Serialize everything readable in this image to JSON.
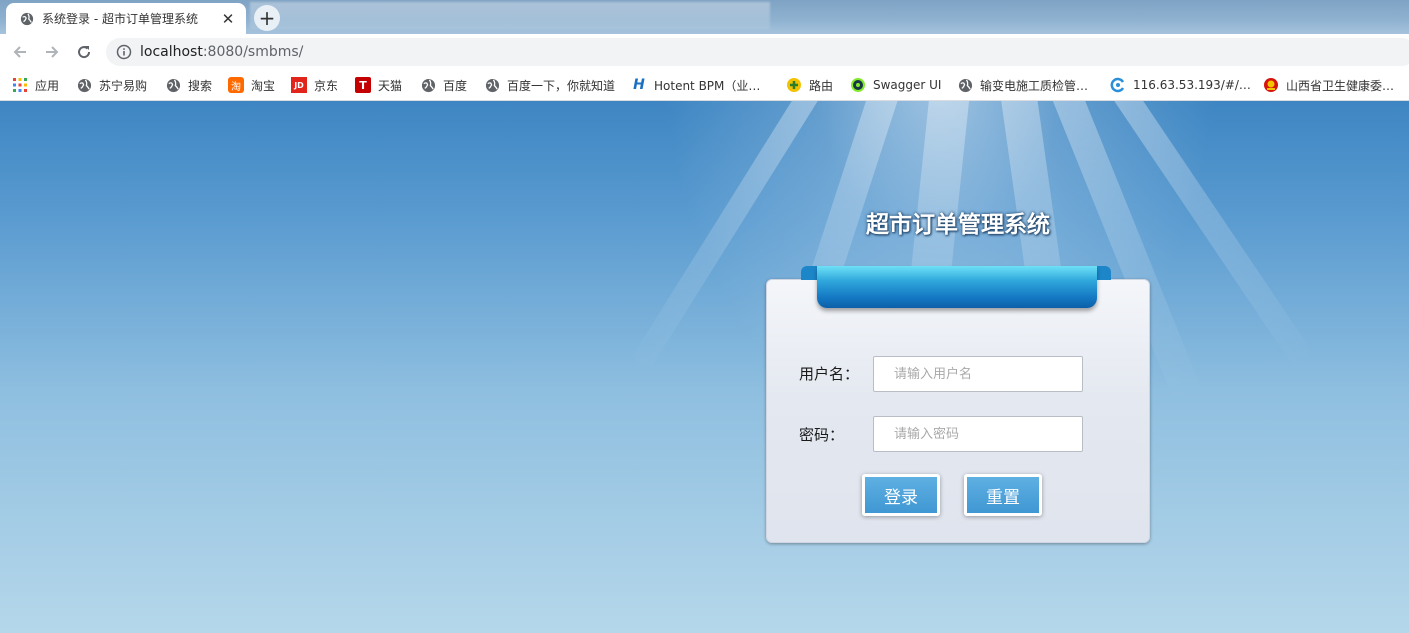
{
  "browser": {
    "tab": {
      "title": "系统登录 - 超市订单管理系统",
      "close": "✕"
    },
    "new_tab": "+",
    "address": {
      "host": "localhost",
      "path": ":8080/smbms/"
    },
    "bookmarks": [
      {
        "label": "应用",
        "icon": "apps-grid-icon"
      },
      {
        "label": "苏宁易购",
        "icon": "globe-icon"
      },
      {
        "label": "搜索",
        "icon": "globe-icon"
      },
      {
        "label": "淘宝",
        "icon": "taobao-icon",
        "badge": "淘"
      },
      {
        "label": "京东",
        "icon": "jd-icon",
        "badge": "JD"
      },
      {
        "label": "天猫",
        "icon": "tmall-icon",
        "badge": "T"
      },
      {
        "label": "百度",
        "icon": "globe-icon"
      },
      {
        "label": "百度一下，你就知道",
        "icon": "globe-icon"
      },
      {
        "label": "Hotent BPM（业…",
        "icon": "hotent-icon",
        "badge": "H"
      },
      {
        "label": "路由",
        "icon": "router-icon"
      },
      {
        "label": "Swagger UI",
        "icon": "swagger-icon"
      },
      {
        "label": "输变电施工质检管…",
        "icon": "globe-icon"
      },
      {
        "label": "116.63.53.193/#/…",
        "icon": "refresh-c-icon"
      },
      {
        "label": "山西省卫生健康委…",
        "icon": "emblem-icon"
      }
    ]
  },
  "login": {
    "system_title": "超市订单管理系统",
    "username_label": "用户名：",
    "username_placeholder": "请输入用户名",
    "password_label": "密码：",
    "password_placeholder": "请输入密码",
    "login_button": "登录",
    "reset_button": "重置"
  },
  "colors": {
    "page_top": "#3e86c3",
    "page_bottom": "#b5d7ea",
    "button": "#4aa0d8",
    "ribbon": "#1478c3"
  }
}
